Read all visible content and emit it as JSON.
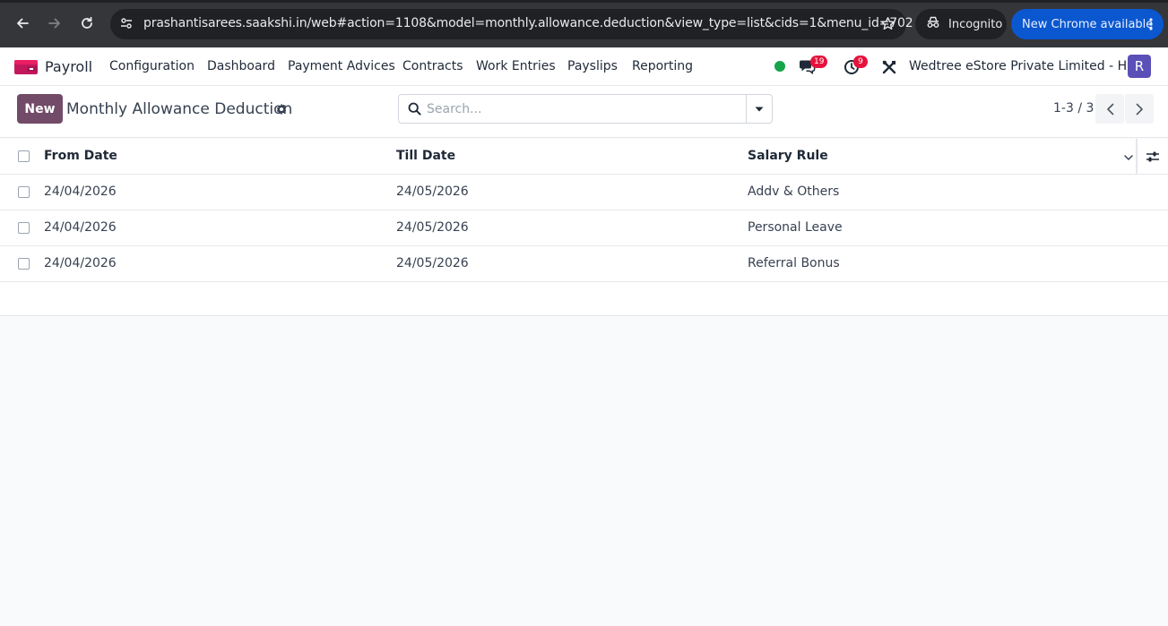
{
  "browser": {
    "url": "prashantisarees.saakshi.in/web#action=1108&model=monthly.allowance.deduction&view_type=list&cids=1&menu_id=702",
    "incognito_label": "Incognito",
    "update_label": "New Chrome available"
  },
  "navbar": {
    "app_name": "Payroll",
    "menu": [
      "Configuration",
      "Dashboard",
      "Payment Advices",
      "Contracts",
      "Work Entries",
      "Payslips",
      "Reporting"
    ],
    "messages_count": "19",
    "activities_count": "9",
    "company": "Wedtree eStore Private Limited - HO",
    "avatar_initial": "R"
  },
  "control_panel": {
    "new_label": "New",
    "title": "Monthly Allowance Deduction",
    "search_placeholder": "Search...",
    "pager": "1-3 / 3"
  },
  "table": {
    "columns": [
      "From Date",
      "Till Date",
      "Salary Rule"
    ],
    "rows": [
      [
        "24/04/2026",
        "24/05/2026",
        "Addv & Others"
      ],
      [
        "24/04/2026",
        "24/05/2026",
        "Personal Leave"
      ],
      [
        "24/04/2026",
        "24/05/2026",
        "Referral Bonus"
      ]
    ]
  },
  "colors": {
    "primary": "#714b67",
    "badge": "#e5133c",
    "presence": "#16a34a",
    "avatar": "#5b4fb8",
    "chrome_update": "#0b57d0"
  }
}
